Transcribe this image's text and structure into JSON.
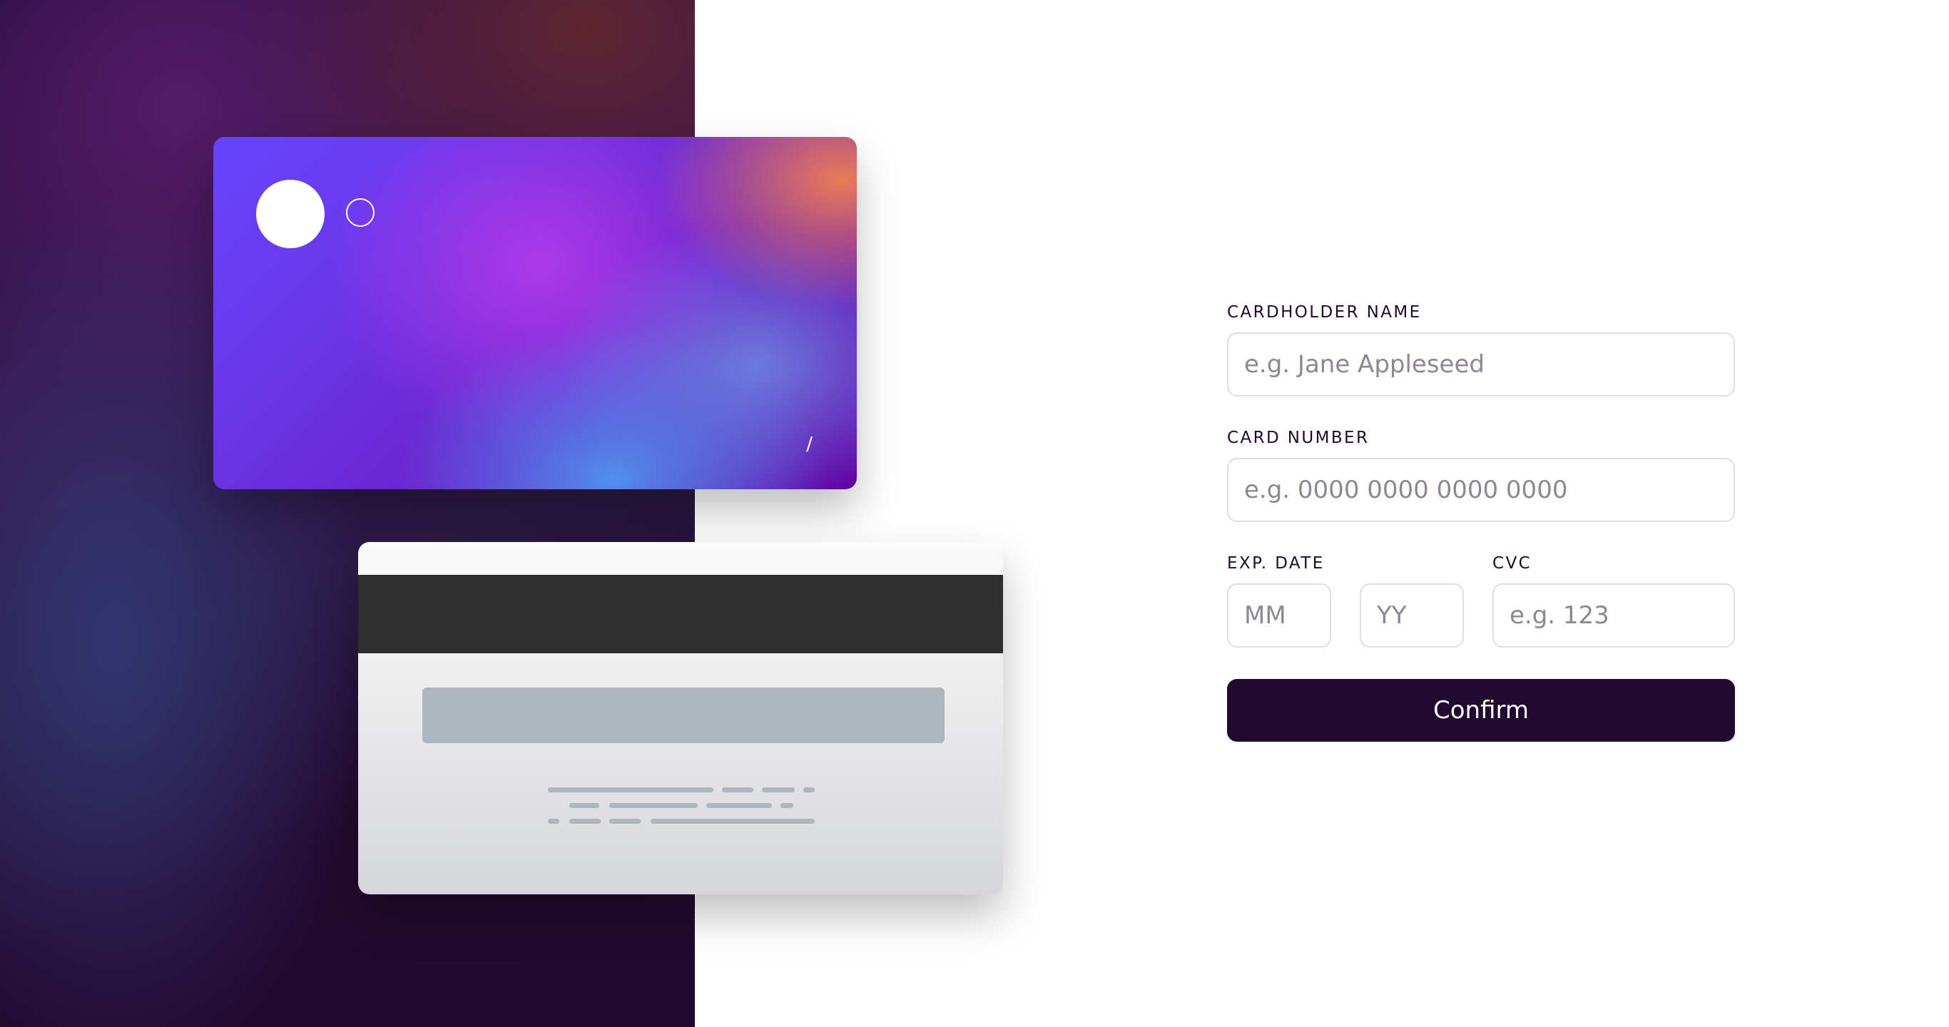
{
  "card_front": {
    "expiry_separator": "/"
  },
  "form": {
    "cardholder": {
      "label": "CARDHOLDER NAME",
      "placeholder": "e.g. Jane Appleseed",
      "value": ""
    },
    "card_number": {
      "label": "CARD NUMBER",
      "placeholder": "e.g. 0000 0000 0000 0000",
      "value": ""
    },
    "exp_date": {
      "label": "EXP. DATE",
      "month_placeholder": "MM",
      "year_placeholder": "YY"
    },
    "cvc": {
      "label": "CVC",
      "placeholder": "e.g. 123",
      "value": ""
    },
    "confirm_label": "Confirm"
  },
  "colors": {
    "dark_violet": "#21092f",
    "input_border": "#dedddf",
    "placeholder": "#8f8694",
    "card_back_bar": "#2f2f2f",
    "card_back_box": "#adb5bd"
  }
}
